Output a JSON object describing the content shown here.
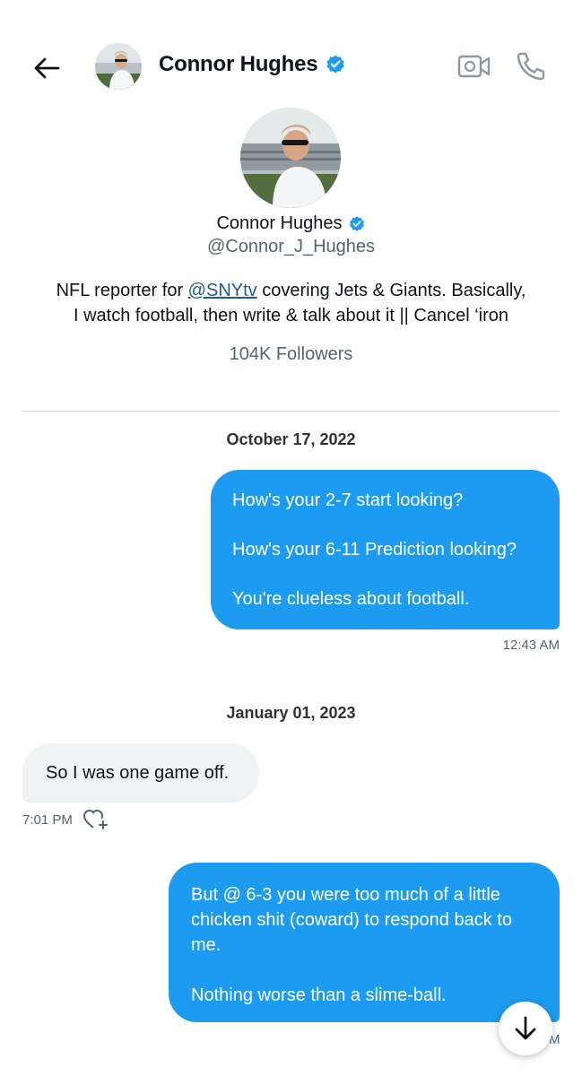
{
  "header": {
    "name": "Connor Hughes",
    "back_icon": "arrow-left-icon",
    "video_icon": "video-call-icon",
    "call_icon": "phone-icon"
  },
  "profile": {
    "name": "Connor Hughes",
    "handle": "@Connor_J_Hughes",
    "bio_prefix": "NFL reporter for ",
    "bio_mention": "@SNYtv",
    "bio_suffix_line1": " covering Jets & Giants. Basically,",
    "bio_line2": "I watch football, then write & talk about it || Cancel ‘iron",
    "followers": "104K Followers"
  },
  "conversation": {
    "dates": [
      "October 17, 2022",
      "January 01, 2023"
    ],
    "messages": [
      {
        "direction": "outgoing",
        "lines": [
          "How's your 2-7 start looking?",
          "How's your 6-11 Prediction looking?",
          "You're clueless about football."
        ],
        "time": "12:43 AM"
      },
      {
        "direction": "incoming",
        "lines": [
          "So I was one game off."
        ],
        "time": "7:01 PM"
      },
      {
        "direction": "outgoing",
        "lines": [
          "But @ 6-3 you were too much of a little",
          "chicken shit (coward) to respond back to",
          "me.",
          "Nothing worse than a slime-ball."
        ],
        "time_visible": "M"
      }
    ]
  },
  "colors": {
    "accent": "#1d9bf0",
    "incoming_bubble": "#eff3f4",
    "secondary_text": "#536471"
  }
}
